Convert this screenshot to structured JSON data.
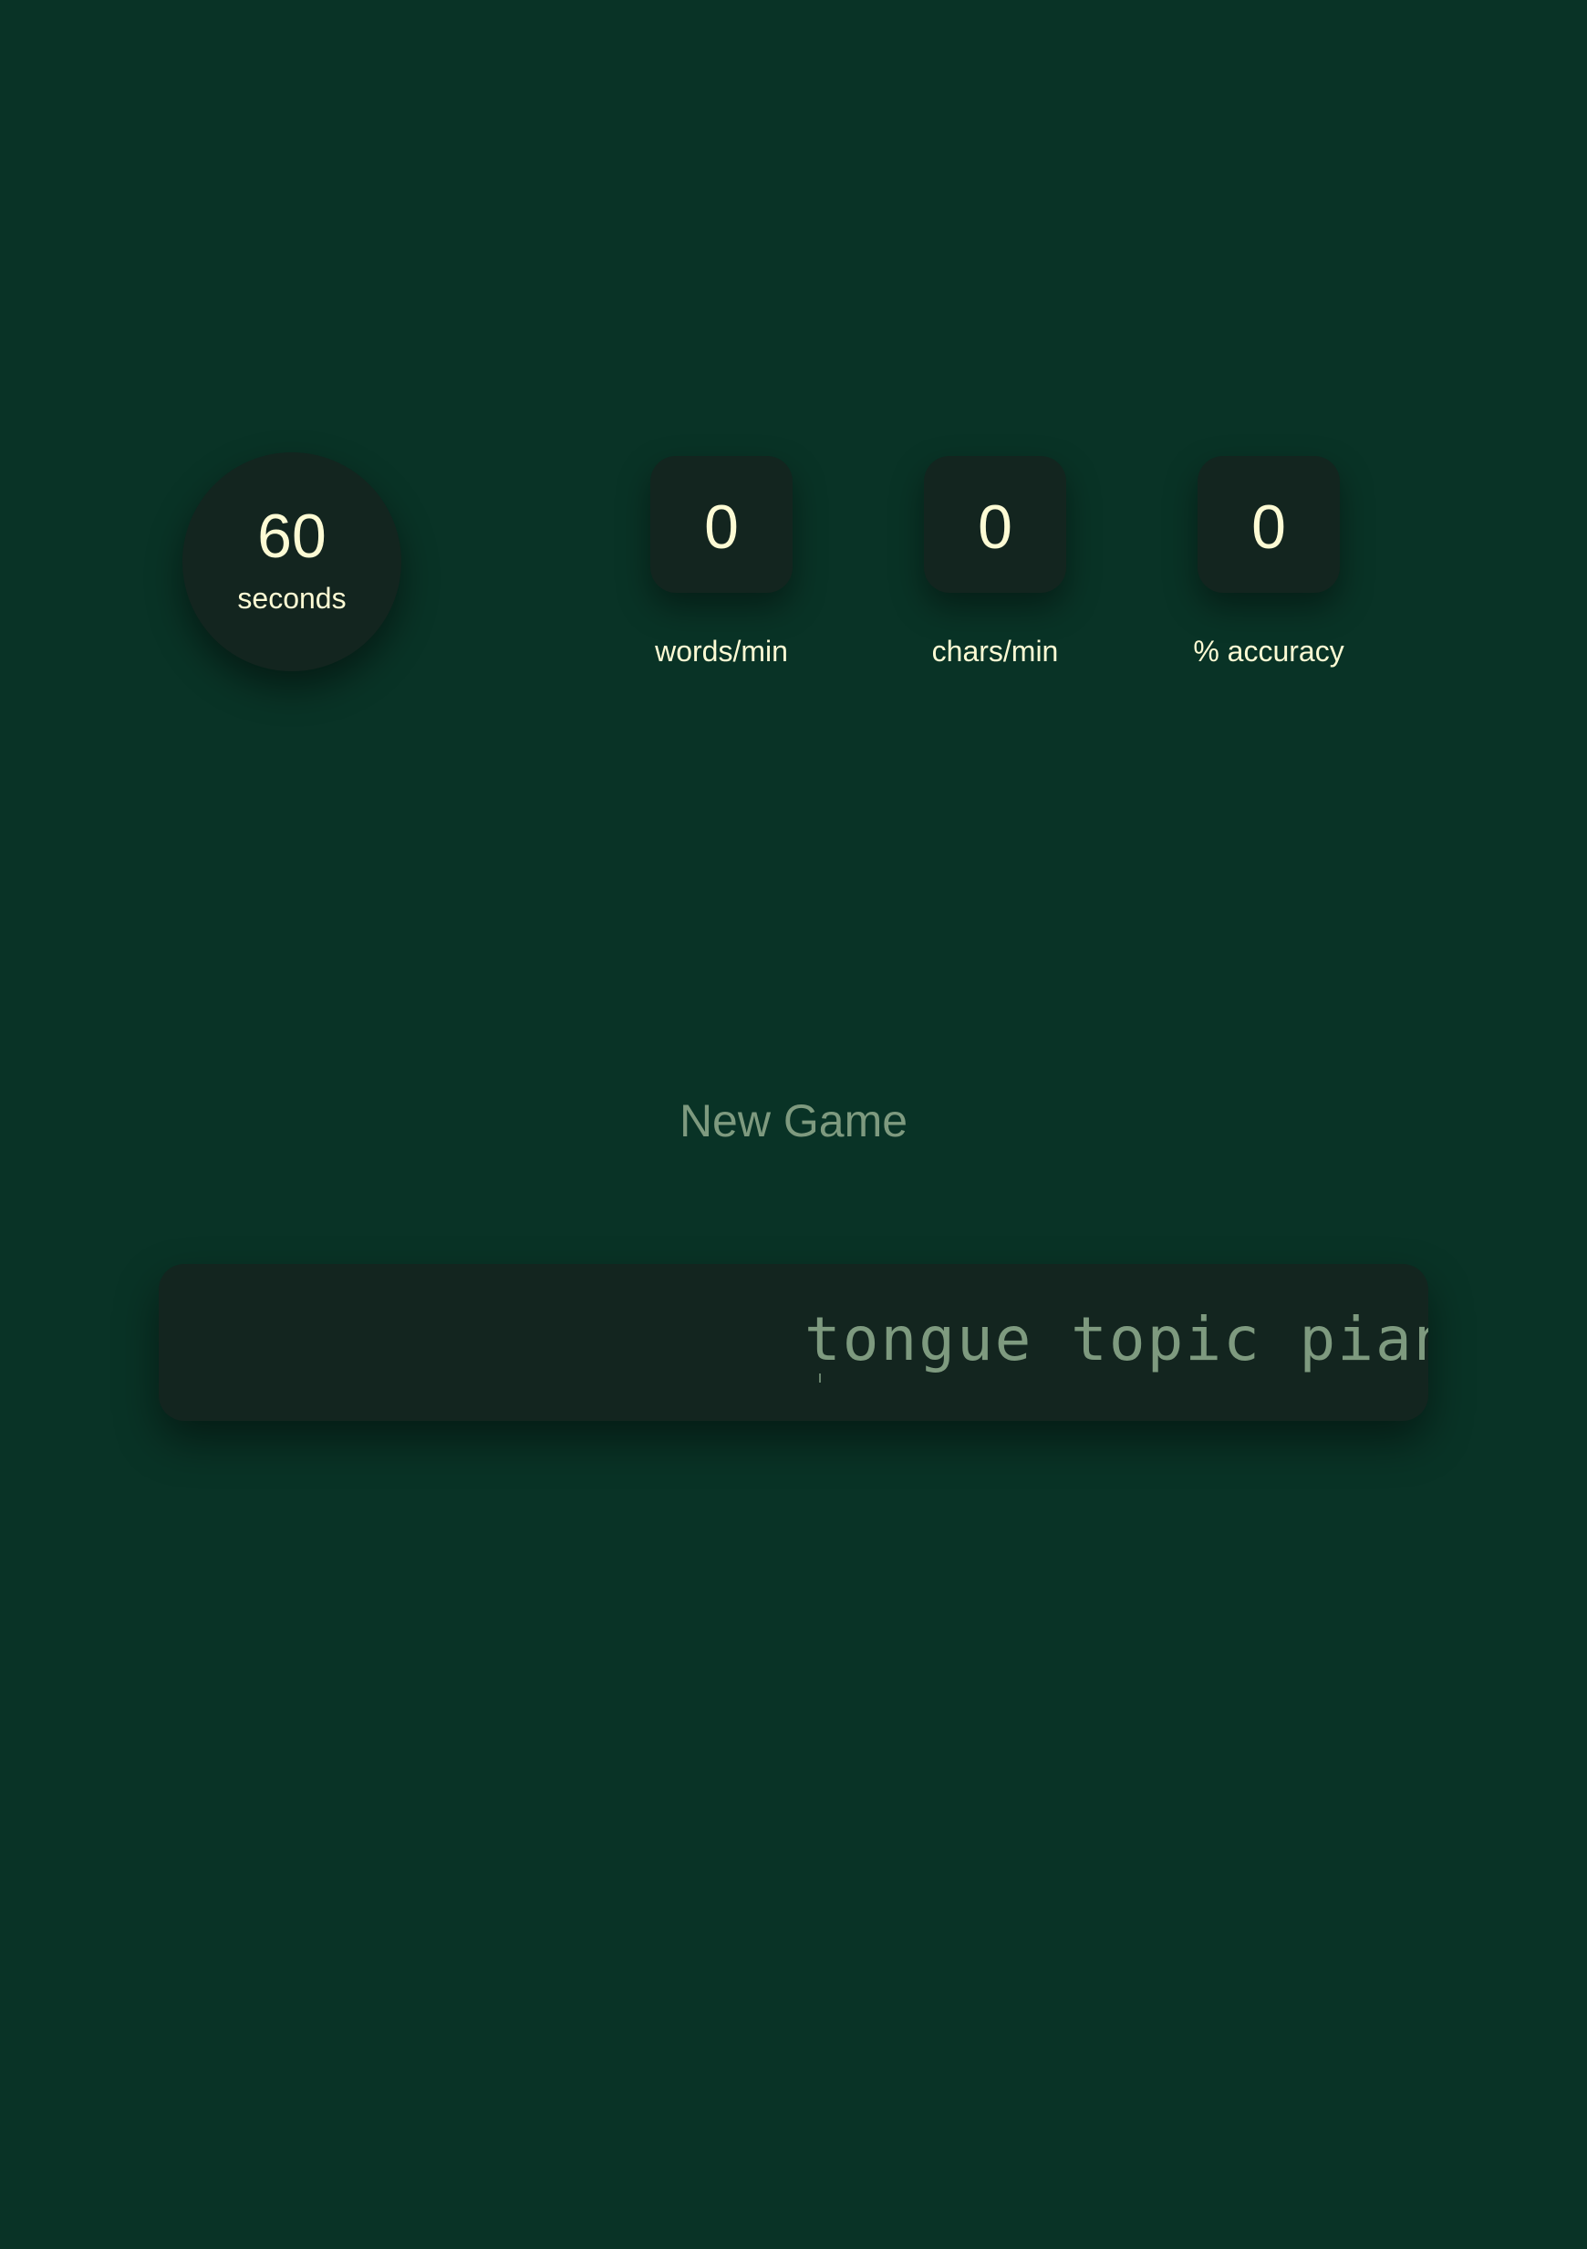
{
  "timer": {
    "value": "60",
    "label": "seconds"
  },
  "stats": [
    {
      "value": "0",
      "label": "words/min"
    },
    {
      "value": "0",
      "label": "chars/min"
    },
    {
      "value": "0",
      "label": "% accuracy"
    }
  ],
  "new_game_label": "New Game",
  "typing": {
    "words": "tongue topic piano c"
  },
  "colors": {
    "background": "#093326",
    "card": "#13251f",
    "text": "#fdfbd4",
    "muted": "#7e9a7f"
  }
}
